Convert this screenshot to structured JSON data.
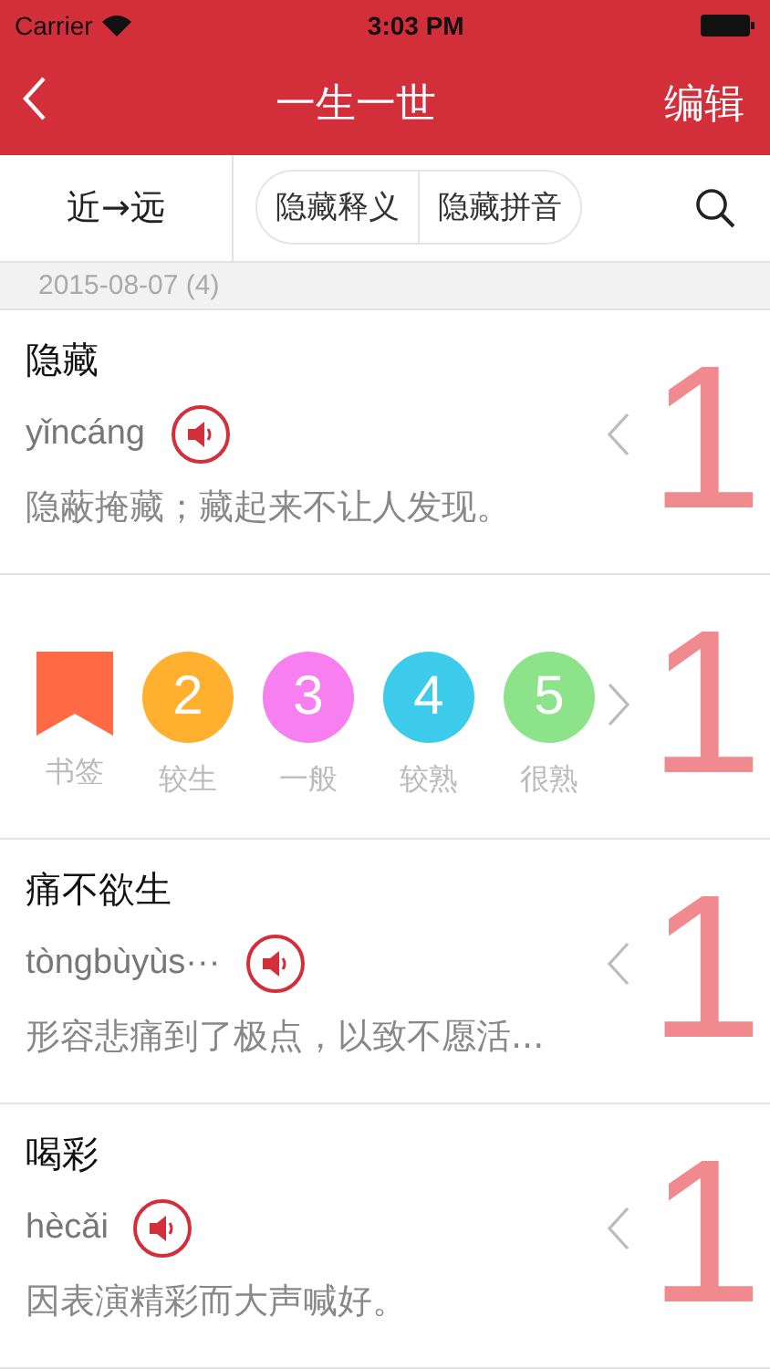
{
  "status_bar": {
    "carrier": "Carrier",
    "time": "3:03 PM"
  },
  "nav": {
    "title": "一生一世",
    "action": "编辑"
  },
  "toolbar": {
    "sort": "近→远",
    "toggles": [
      {
        "label": "隐藏释义"
      },
      {
        "label": "隐藏拼音"
      }
    ]
  },
  "section": {
    "header": "2015-08-07 (4)"
  },
  "rows": [
    {
      "kind": "entry",
      "word": "隐藏",
      "pinyin": "yǐncáng",
      "definition": "隐蔽掩藏；藏起来不让人发现。",
      "rank": "1"
    },
    {
      "kind": "levels",
      "rank": "1",
      "levels": [
        {
          "kind": "bookmark",
          "label": "书签",
          "color": "#ff6a45"
        },
        {
          "kind": "circle",
          "number": "2",
          "label": "较生",
          "color": "#ffb02e"
        },
        {
          "kind": "circle",
          "number": "3",
          "label": "一般",
          "color": "#f77ff0"
        },
        {
          "kind": "circle",
          "number": "4",
          "label": "较熟",
          "color": "#3ccbeb"
        },
        {
          "kind": "circle",
          "number": "5",
          "label": "很熟",
          "color": "#8de38a"
        }
      ]
    },
    {
      "kind": "entry",
      "word": "痛不欲生",
      "pinyin": "tòngbùyùs···",
      "definition": "形容悲痛到了极点，以致不愿活...",
      "rank": "1"
    },
    {
      "kind": "entry",
      "word": "喝彩",
      "pinyin": "hècǎi",
      "definition": "因表演精彩而大声喊好。",
      "rank": "1"
    }
  ]
}
